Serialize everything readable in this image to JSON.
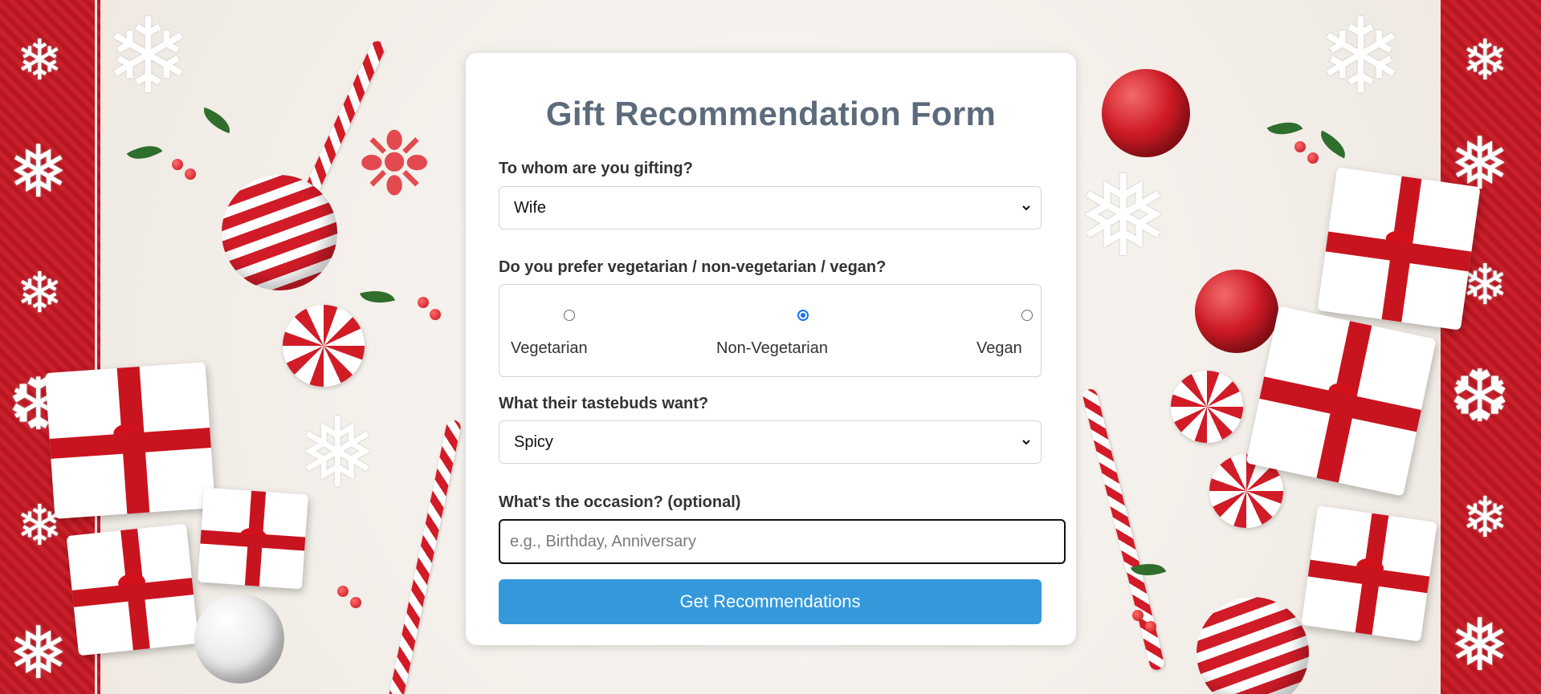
{
  "form": {
    "title": "Gift Recommendation Form",
    "recipient": {
      "label": "To whom are you gifting?",
      "selected": "Wife"
    },
    "diet": {
      "label": "Do you prefer vegetarian / non-vegetarian / vegan?",
      "options": [
        {
          "label": "Vegetarian",
          "checked": false
        },
        {
          "label": "Non-Vegetarian",
          "checked": true
        },
        {
          "label": "Vegan",
          "checked": false
        }
      ]
    },
    "taste": {
      "label": "What their tastebuds want?",
      "selected": "Spicy"
    },
    "occasion": {
      "label": "What's the occasion? (optional)",
      "placeholder": "e.g., Birthday, Anniversary",
      "value": ""
    },
    "submit_label": "Get Recommendations"
  },
  "icons": {
    "select_arrow": "chevron-down-icon",
    "background_theme": "christmas-decorations"
  },
  "colors": {
    "title": "#5c6b7b",
    "button": "#3498db",
    "radio_checked": "#1a73e8",
    "background_red": "#c8212b"
  }
}
